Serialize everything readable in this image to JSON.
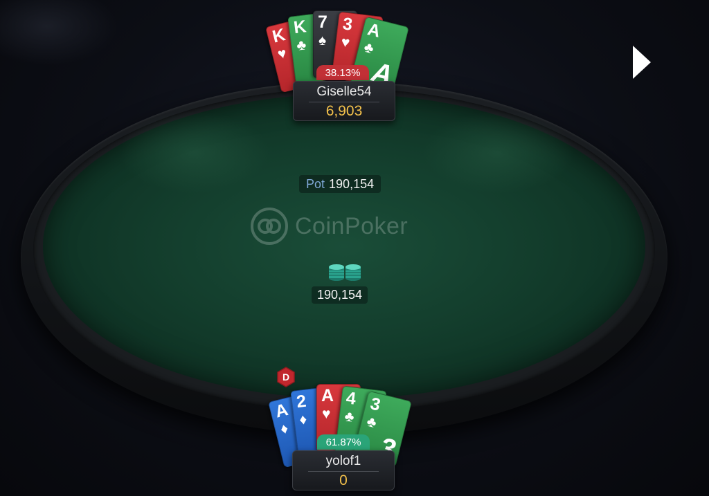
{
  "brand": {
    "name": "CoinPoker"
  },
  "pot": {
    "label": "Pot",
    "amount": "190,154"
  },
  "center_chips": {
    "amount": "190,154"
  },
  "players": {
    "top": {
      "name": "Giselle54",
      "stack": "6,903",
      "equity": "38.13%",
      "cards": [
        {
          "rank": "K",
          "suit": "♥",
          "color": "red"
        },
        {
          "rank": "K",
          "suit": "♣",
          "color": "green"
        },
        {
          "rank": "7",
          "suit": "♠",
          "color": "black"
        },
        {
          "rank": "3",
          "suit": "♥",
          "color": "red"
        },
        {
          "rank": "A",
          "suit": "♣",
          "color": "green"
        }
      ]
    },
    "bottom": {
      "name": "yolof1",
      "stack": "0",
      "equity": "61.87%",
      "dealer_label": "D",
      "cards": [
        {
          "rank": "A",
          "suit": "♦",
          "color": "blue"
        },
        {
          "rank": "2",
          "suit": "♦",
          "color": "blue"
        },
        {
          "rank": "A",
          "suit": "♥",
          "color": "red"
        },
        {
          "rank": "4",
          "suit": "♣",
          "color": "green"
        },
        {
          "rank": "3",
          "suit": "♣",
          "color": "green"
        }
      ]
    }
  },
  "colors": {
    "felt": "#133d2c",
    "stack_gold": "#f3c14b",
    "equity_lose": "#c23036",
    "equity_win": "#2aa478",
    "pot_label": "#7fa8d6"
  },
  "icons": {
    "play": "play-icon",
    "dealer": "dealer-button-icon",
    "chips": "chip-stack-icon",
    "logo": "coinpoker-logo-icon"
  }
}
